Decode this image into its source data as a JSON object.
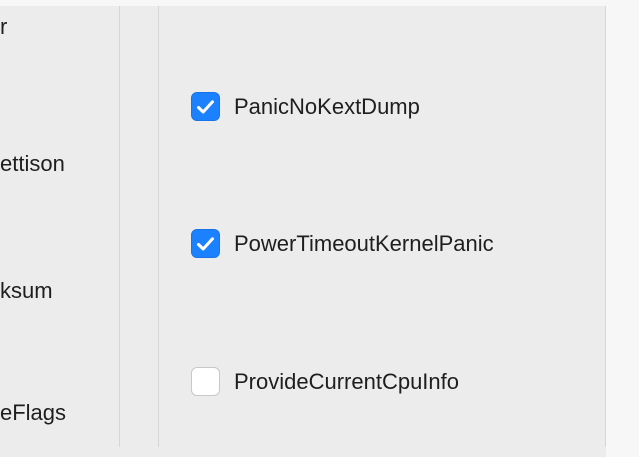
{
  "left_column": {
    "labels": [
      "r",
      "ettison",
      "ksum",
      "eFlags"
    ]
  },
  "options": [
    {
      "label": "PanicNoKextDump",
      "checked": true
    },
    {
      "label": "PowerTimeoutKernelPanic",
      "checked": true
    },
    {
      "label": "ProvideCurrentCpuInfo",
      "checked": false
    }
  ],
  "colors": {
    "accent": "#1c81ff",
    "background": "#ececec"
  }
}
